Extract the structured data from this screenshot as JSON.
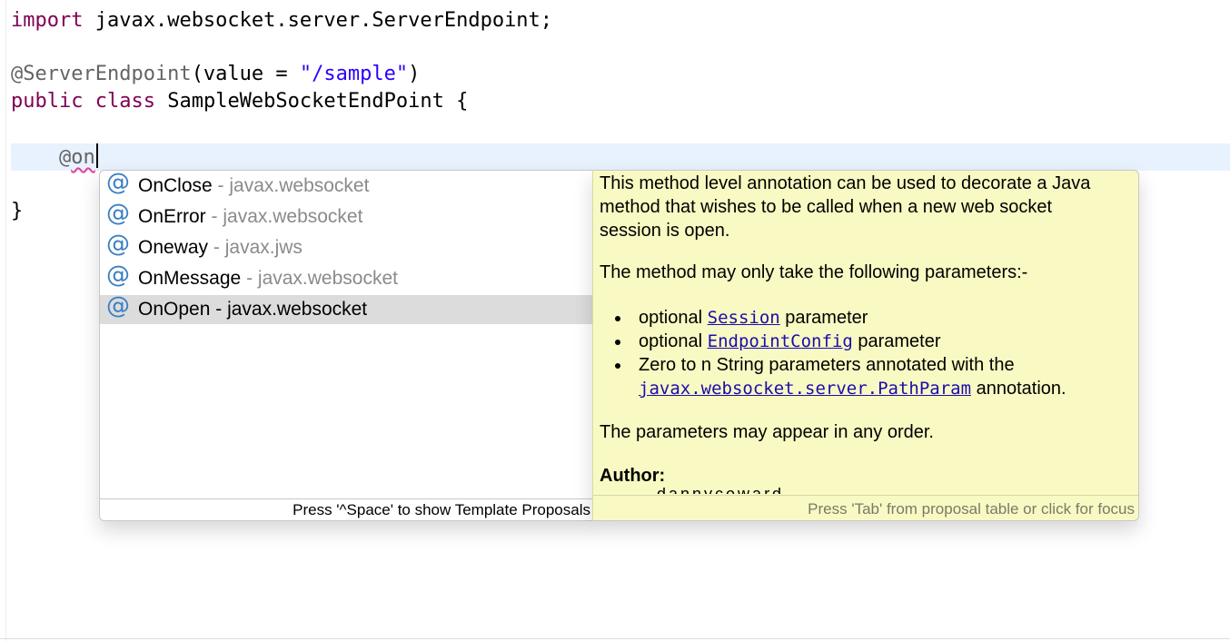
{
  "editor": {
    "line1": {
      "kw": "import",
      "rest": " javax.websocket.server.ServerEndpoint;"
    },
    "line2": {
      "annotation": "@ServerEndpoint",
      "mid": "(value = ",
      "string": "\"/sample\"",
      "end": ")"
    },
    "line3": {
      "kw1": "public",
      "kw2": "class",
      "rest": " SampleWebSocketEndPoint {"
    },
    "line4": {
      "indent": "    ",
      "at": "@",
      "typed": "on"
    },
    "line5": {
      "text": "}"
    }
  },
  "proposals": {
    "items": [
      {
        "name": "OnClose",
        "sep": " - ",
        "package": "javax.websocket",
        "icon": "annotation-icon",
        "selected": false
      },
      {
        "name": "OnError",
        "sep": " - ",
        "package": "javax.websocket",
        "icon": "annotation-icon",
        "selected": false
      },
      {
        "name": "Oneway",
        "sep": " - ",
        "package": "javax.jws",
        "icon": "annotation-icon",
        "selected": false
      },
      {
        "name": "OnMessage",
        "sep": " - ",
        "package": "javax.websocket",
        "icon": "annotation-icon",
        "selected": false
      },
      {
        "name": "OnOpen",
        "sep": " - ",
        "package": "javax.websocket",
        "icon": "annotation-icon",
        "selected": true
      }
    ],
    "icon_glyph": "@",
    "footer": "Press '^Space' to show Template Proposals"
  },
  "docs": {
    "para1": "This method level annotation can be used to decorate a Java method that wishes to be called when a new web socket session is open.",
    "para2": "The method may only take the following parameters:-",
    "bullet1": {
      "before": "optional ",
      "link": "Session",
      "after": " parameter"
    },
    "bullet2": {
      "before": "optional ",
      "link": "EndpointConfig",
      "after": " parameter"
    },
    "bullet3": {
      "before": "Zero to n String parameters annotated with the ",
      "link": "javax.websocket.server.PathParam",
      "after": " annotation."
    },
    "para3": "The parameters may appear in any order.",
    "author_label": "Author:",
    "author_value": "dannycoward",
    "footer": "Press 'Tab' from proposal table or click for focus"
  },
  "colors": {
    "keyword": "#7f0055",
    "annotation": "#646464",
    "string": "#2a00ff",
    "current_line": "#e8f2fe",
    "doc_background": "#f9f9c3",
    "selection": "#dcdcdc",
    "link": "#1a0dab"
  }
}
